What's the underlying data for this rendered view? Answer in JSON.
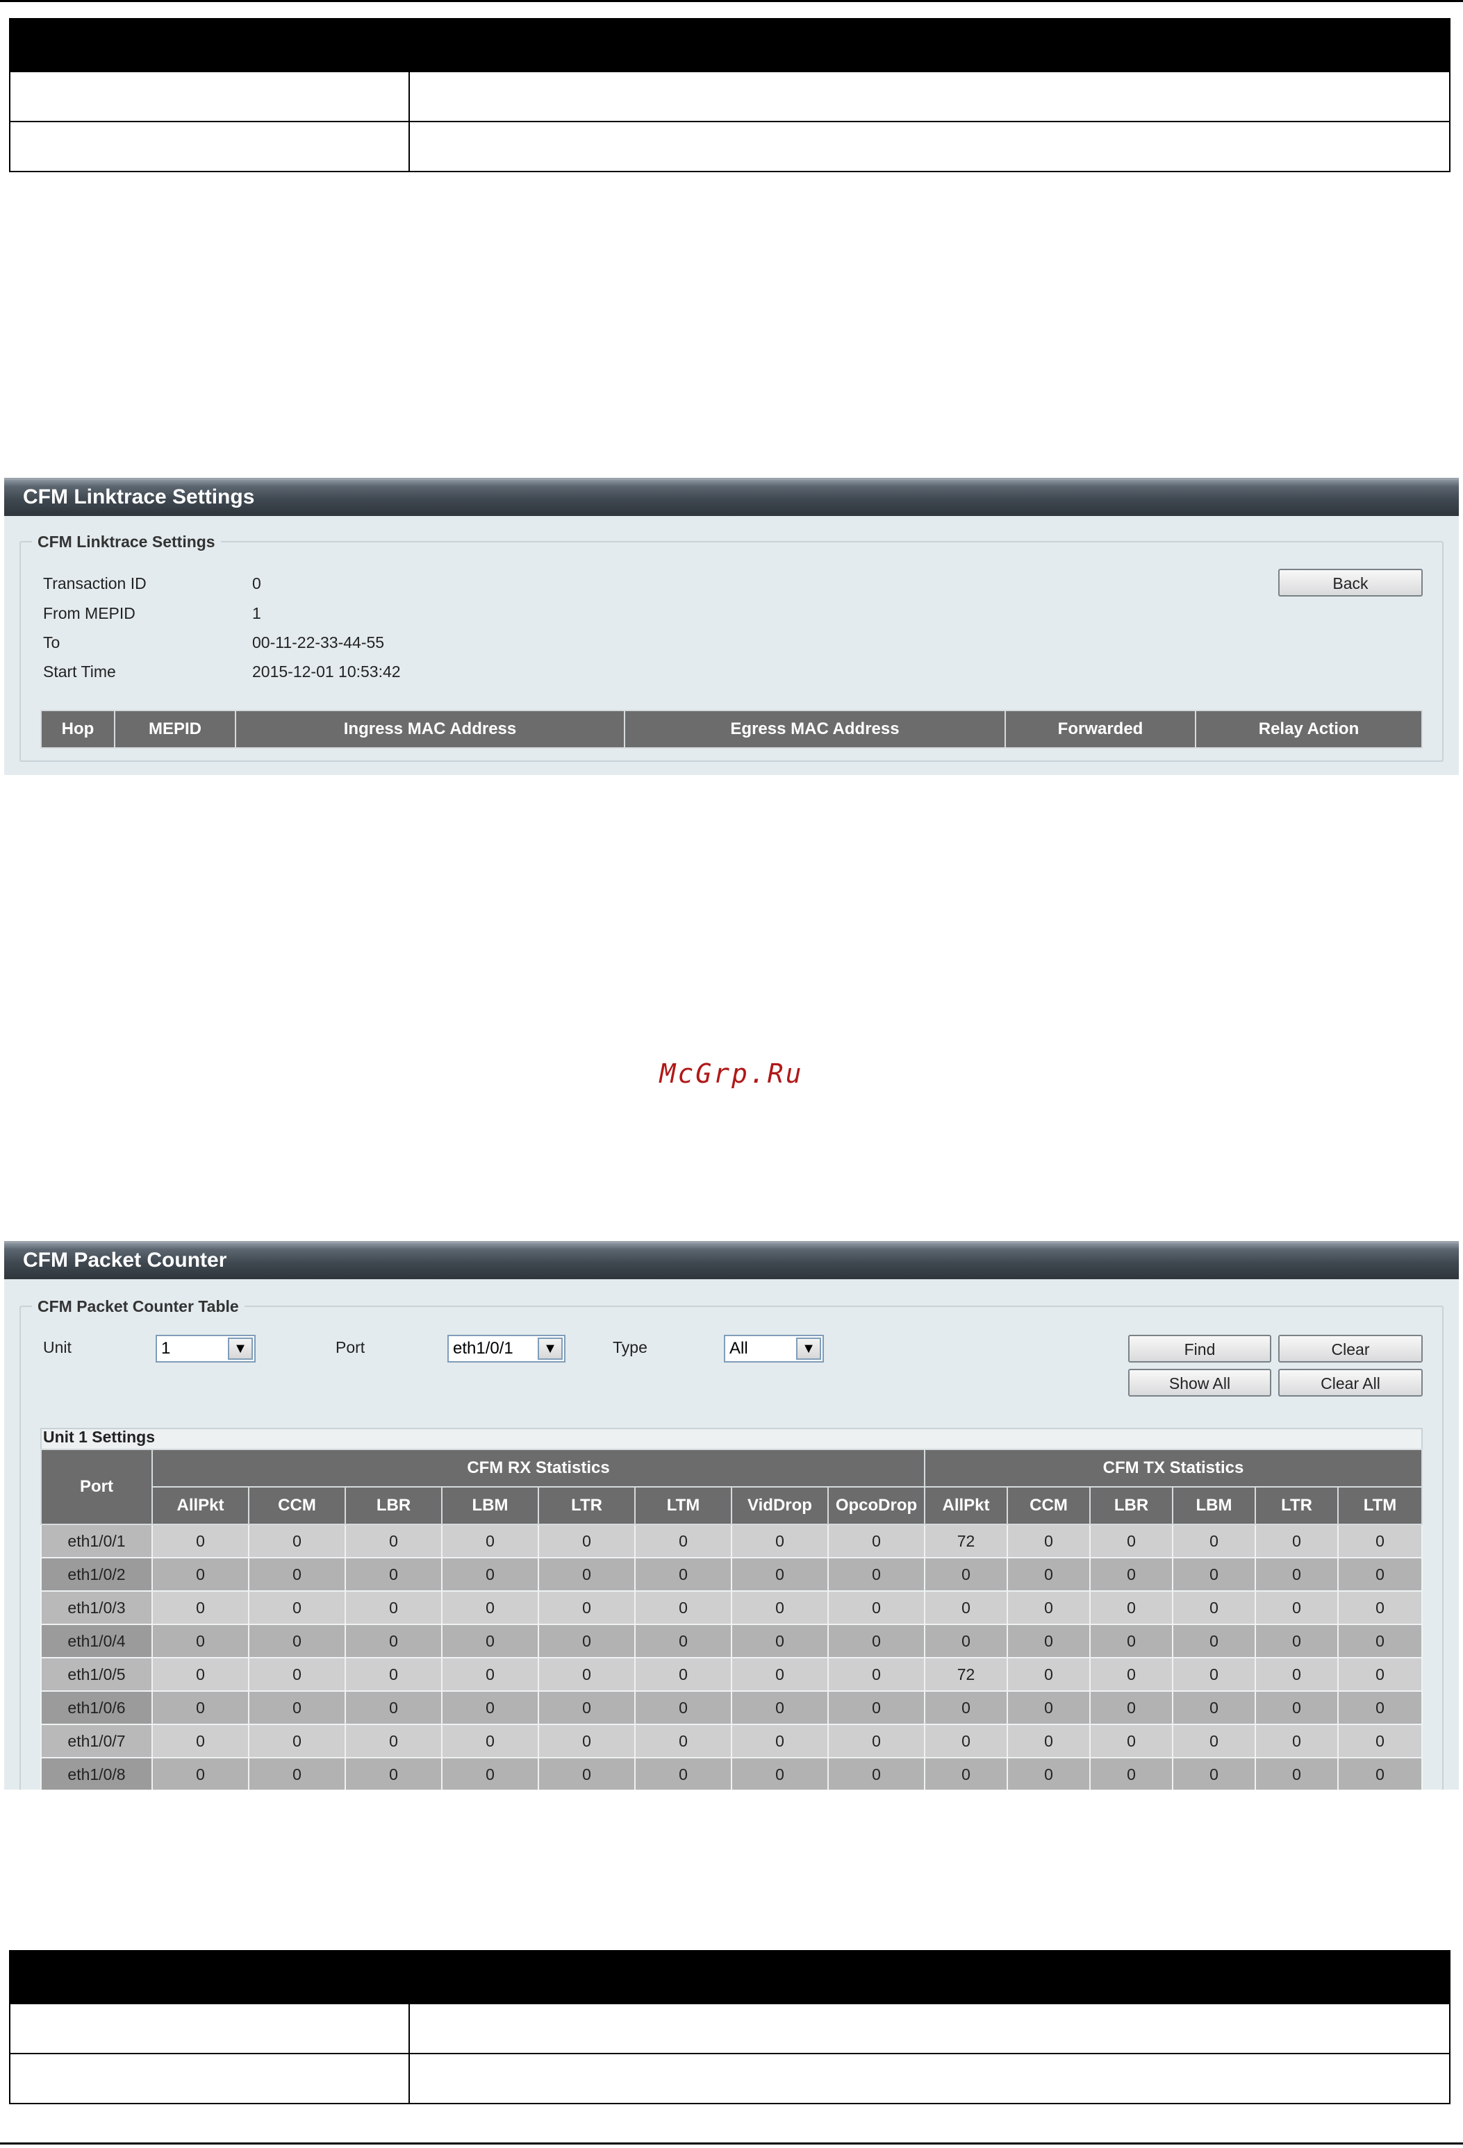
{
  "linktrace": {
    "title": "CFM Linktrace Settings",
    "section": "CFM Linktrace Settings",
    "fields": [
      {
        "label": "Transaction ID",
        "value": "0"
      },
      {
        "label": "From MEPID",
        "value": "1"
      },
      {
        "label": "To",
        "value": "00-11-22-33-44-55"
      },
      {
        "label": "Start Time",
        "value": "2015-12-01 10:53:42"
      }
    ],
    "back_label": "Back",
    "columns": [
      "Hop",
      "MEPID",
      "Ingress MAC Address",
      "Egress MAC Address",
      "Forwarded",
      "Relay Action"
    ]
  },
  "watermark": "McGrp.Ru",
  "counter": {
    "title": "CFM Packet Counter",
    "section": "CFM Packet Counter Table",
    "unit_label": "Unit",
    "unit_value": "1",
    "port_label": "Port",
    "port_value": "eth1/0/1",
    "type_label": "Type",
    "type_value": "All",
    "find_label": "Find",
    "clear_label": "Clear",
    "show_all_label": "Show All",
    "clear_all_label": "Clear All",
    "unit_settings": "Unit 1 Settings",
    "port_header": "Port",
    "rx_header": "CFM RX Statistics",
    "tx_header": "CFM TX Statistics",
    "rx_columns": [
      "AllPkt",
      "CCM",
      "LBR",
      "LBM",
      "LTR",
      "LTM",
      "VidDrop",
      "OpcoDrop"
    ],
    "tx_columns": [
      "AllPkt",
      "CCM",
      "LBR",
      "LBM",
      "LTR",
      "LTM"
    ],
    "rows": [
      {
        "port": "eth1/0/1",
        "rx": [
          "0",
          "0",
          "0",
          "0",
          "0",
          "0",
          "0",
          "0"
        ],
        "tx": [
          "72",
          "0",
          "0",
          "0",
          "0",
          "0"
        ]
      },
      {
        "port": "eth1/0/2",
        "rx": [
          "0",
          "0",
          "0",
          "0",
          "0",
          "0",
          "0",
          "0"
        ],
        "tx": [
          "0",
          "0",
          "0",
          "0",
          "0",
          "0"
        ]
      },
      {
        "port": "eth1/0/3",
        "rx": [
          "0",
          "0",
          "0",
          "0",
          "0",
          "0",
          "0",
          "0"
        ],
        "tx": [
          "0",
          "0",
          "0",
          "0",
          "0",
          "0"
        ]
      },
      {
        "port": "eth1/0/4",
        "rx": [
          "0",
          "0",
          "0",
          "0",
          "0",
          "0",
          "0",
          "0"
        ],
        "tx": [
          "0",
          "0",
          "0",
          "0",
          "0",
          "0"
        ]
      },
      {
        "port": "eth1/0/5",
        "rx": [
          "0",
          "0",
          "0",
          "0",
          "0",
          "0",
          "0",
          "0"
        ],
        "tx": [
          "72",
          "0",
          "0",
          "0",
          "0",
          "0"
        ]
      },
      {
        "port": "eth1/0/6",
        "rx": [
          "0",
          "0",
          "0",
          "0",
          "0",
          "0",
          "0",
          "0"
        ],
        "tx": [
          "0",
          "0",
          "0",
          "0",
          "0",
          "0"
        ]
      },
      {
        "port": "eth1/0/7",
        "rx": [
          "0",
          "0",
          "0",
          "0",
          "0",
          "0",
          "0",
          "0"
        ],
        "tx": [
          "0",
          "0",
          "0",
          "0",
          "0",
          "0"
        ]
      },
      {
        "port": "eth1/0/8",
        "rx": [
          "0",
          "0",
          "0",
          "0",
          "0",
          "0",
          "0",
          "0"
        ],
        "tx": [
          "0",
          "0",
          "0",
          "0",
          "0",
          "0"
        ]
      }
    ]
  }
}
